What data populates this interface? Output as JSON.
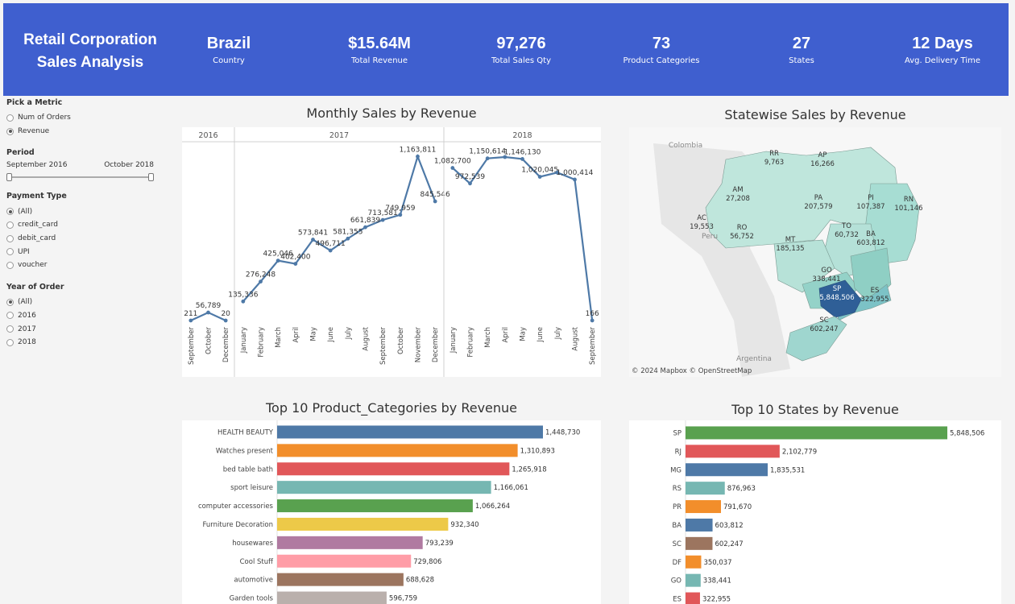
{
  "header": {
    "title_line1": "Retail Corporation",
    "title_line2": "Sales Analysis",
    "kpis": [
      {
        "value": "Brazil",
        "label": "Country"
      },
      {
        "value": "$15.64M",
        "label": "Total Revenue"
      },
      {
        "value": "97,276",
        "label": "Total Sales Qty"
      },
      {
        "value": "73",
        "label": "Product Categories"
      },
      {
        "value": "27",
        "label": "States"
      },
      {
        "value": "12 Days",
        "label": "Avg. Delivery Time"
      }
    ]
  },
  "filters": {
    "metric": {
      "title": "Pick a Metric",
      "options": [
        "Num of Orders",
        "Revenue"
      ],
      "selected": 1
    },
    "period": {
      "title": "Period",
      "start": "September 2016",
      "end": "October 2018"
    },
    "payment": {
      "title": "Payment Type",
      "options": [
        "(All)",
        "credit_card",
        "debit_card",
        "UPI",
        "voucher"
      ],
      "selected": 0
    },
    "year": {
      "title": "Year of Order",
      "options": [
        "(All)",
        "2016",
        "2017",
        "2018"
      ],
      "selected": 0
    }
  },
  "charts": {
    "monthly_title": "Monthly Sales by Revenue",
    "map_title": "Statewise Sales by Revenue",
    "categories_title": "Top 10 Product_Categories by Revenue",
    "states_title": "Top 10  States by Revenue",
    "map_credit": "© 2024 Mapbox © OpenStreetMap"
  },
  "chart_data": [
    {
      "type": "line",
      "title": "Monthly Sales by Revenue",
      "color": "#4e79a7",
      "panes": [
        {
          "year": "2016",
          "points": [
            {
              "month": "September",
              "value": 211,
              "label": "211"
            },
            {
              "month": "October",
              "value": 56789,
              "label": "56,789"
            },
            {
              "month": "December",
              "value": 20,
              "label": "20"
            }
          ]
        },
        {
          "year": "2017",
          "points": [
            {
              "month": "January",
              "value": 135336,
              "label": "135,336"
            },
            {
              "month": "February",
              "value": 276248,
              "label": "276,248"
            },
            {
              "month": "March",
              "value": 425046,
              "label": "425,046"
            },
            {
              "month": "April",
              "value": 402400,
              "label": "402,400"
            },
            {
              "month": "May",
              "value": 573841,
              "label": "573,841"
            },
            {
              "month": "June",
              "value": 496711,
              "label": "496,711"
            },
            {
              "month": "July",
              "value": 581355,
              "label": "581,355"
            },
            {
              "month": "August",
              "value": 661839,
              "label": "661,839"
            },
            {
              "month": "September",
              "value": 713581,
              "label": "713,581"
            },
            {
              "month": "October",
              "value": 749959,
              "label": "749,959"
            },
            {
              "month": "November",
              "value": 1163811,
              "label": "1,163,811"
            },
            {
              "month": "December",
              "value": 845546,
              "label": "845,546"
            }
          ]
        },
        {
          "year": "2018",
          "points": [
            {
              "month": "January",
              "value": 1082700,
              "label": "1,082,700"
            },
            {
              "month": "February",
              "value": 972539,
              "label": "972,539"
            },
            {
              "month": "March",
              "value": 1150614,
              "label": "1,150,614"
            },
            {
              "month": "April",
              "value": 1160000,
              "label": ""
            },
            {
              "month": "May",
              "value": 1146130,
              "label": "1,146,130"
            },
            {
              "month": "June",
              "value": 1020045,
              "label": "1,020,045"
            },
            {
              "month": "July",
              "value": 1050000,
              "label": ""
            },
            {
              "month": "August",
              "value": 1000414,
              "label": "1,000,414"
            },
            {
              "month": "September",
              "value": 166,
              "label": "166"
            }
          ]
        }
      ]
    },
    {
      "type": "bar",
      "title": "Top 10 Product_Categories by Revenue",
      "categories": [
        "HEALTH BEAUTY",
        "Watches present",
        "bed table bath",
        "sport leisure",
        "computer accessories",
        "Furniture Decoration",
        "housewares",
        "Cool Stuff",
        "automotive",
        "Garden tools"
      ],
      "values": [
        1448730,
        1310893,
        1265918,
        1166061,
        1066264,
        932340,
        793239,
        729806,
        688628,
        596759
      ],
      "labels": [
        "1,448,730",
        "1,310,893",
        "1,265,918",
        "1,166,061",
        "1,066,264",
        "932,340",
        "793,239",
        "729,806",
        "688,628",
        "596,759"
      ],
      "colors": [
        "#4e79a7",
        "#f28e2b",
        "#e15759",
        "#76b7b2",
        "#59a14f",
        "#edc948",
        "#b07aa1",
        "#ff9da7",
        "#9c755f",
        "#bab0ac"
      ]
    },
    {
      "type": "bar",
      "title": "Top 10  States by Revenue",
      "categories": [
        "SP",
        "RJ",
        "MG",
        "RS",
        "PR",
        "BA",
        "SC",
        "DF",
        "GO",
        "ES"
      ],
      "values": [
        5848506,
        2102779,
        1835531,
        876963,
        791670,
        603812,
        602247,
        350037,
        338441,
        322955
      ],
      "labels": [
        "5,848,506",
        "2,102,779",
        "1,835,531",
        "876,963",
        "791,670",
        "603,812",
        "602,247",
        "350,037",
        "338,441",
        "322,955"
      ],
      "colors": [
        "#59a14f",
        "#e15759",
        "#4e79a7",
        "#76b7b2",
        "#f28e2b",
        "#4e79a7",
        "#9c755f",
        "#f28e2b",
        "#76b7b2",
        "#e15759"
      ]
    },
    {
      "type": "map",
      "title": "Statewise Sales by Revenue",
      "countries": [
        "Colombia",
        "Peru",
        "Argentina"
      ],
      "states": [
        {
          "code": "RR",
          "value": 9763,
          "label": "9,763"
        },
        {
          "code": "AP",
          "value": 16266,
          "label": "16,266"
        },
        {
          "code": "AM",
          "value": 27208,
          "label": "27,208"
        },
        {
          "code": "PA",
          "value": 207579,
          "label": "207,579"
        },
        {
          "code": "PI",
          "value": 107387,
          "label": "107,387"
        },
        {
          "code": "RN",
          "value": 101146,
          "label": "101,146"
        },
        {
          "code": "AC",
          "value": 19553,
          "label": "19,553"
        },
        {
          "code": "RO",
          "value": 56752,
          "label": "56,752"
        },
        {
          "code": "TO",
          "value": 60732,
          "label": "60,732"
        },
        {
          "code": "BA",
          "value": 603812,
          "label": "603,812"
        },
        {
          "code": "MT",
          "value": 185135,
          "label": "185,135"
        },
        {
          "code": "GO",
          "value": 338441,
          "label": "338,441"
        },
        {
          "code": "ES",
          "value": 322955,
          "label": "322,955"
        },
        {
          "code": "SP",
          "value": 5848506,
          "label": "5,848,506"
        },
        {
          "code": "SC",
          "value": 602247,
          "label": "602,247"
        }
      ]
    }
  ]
}
